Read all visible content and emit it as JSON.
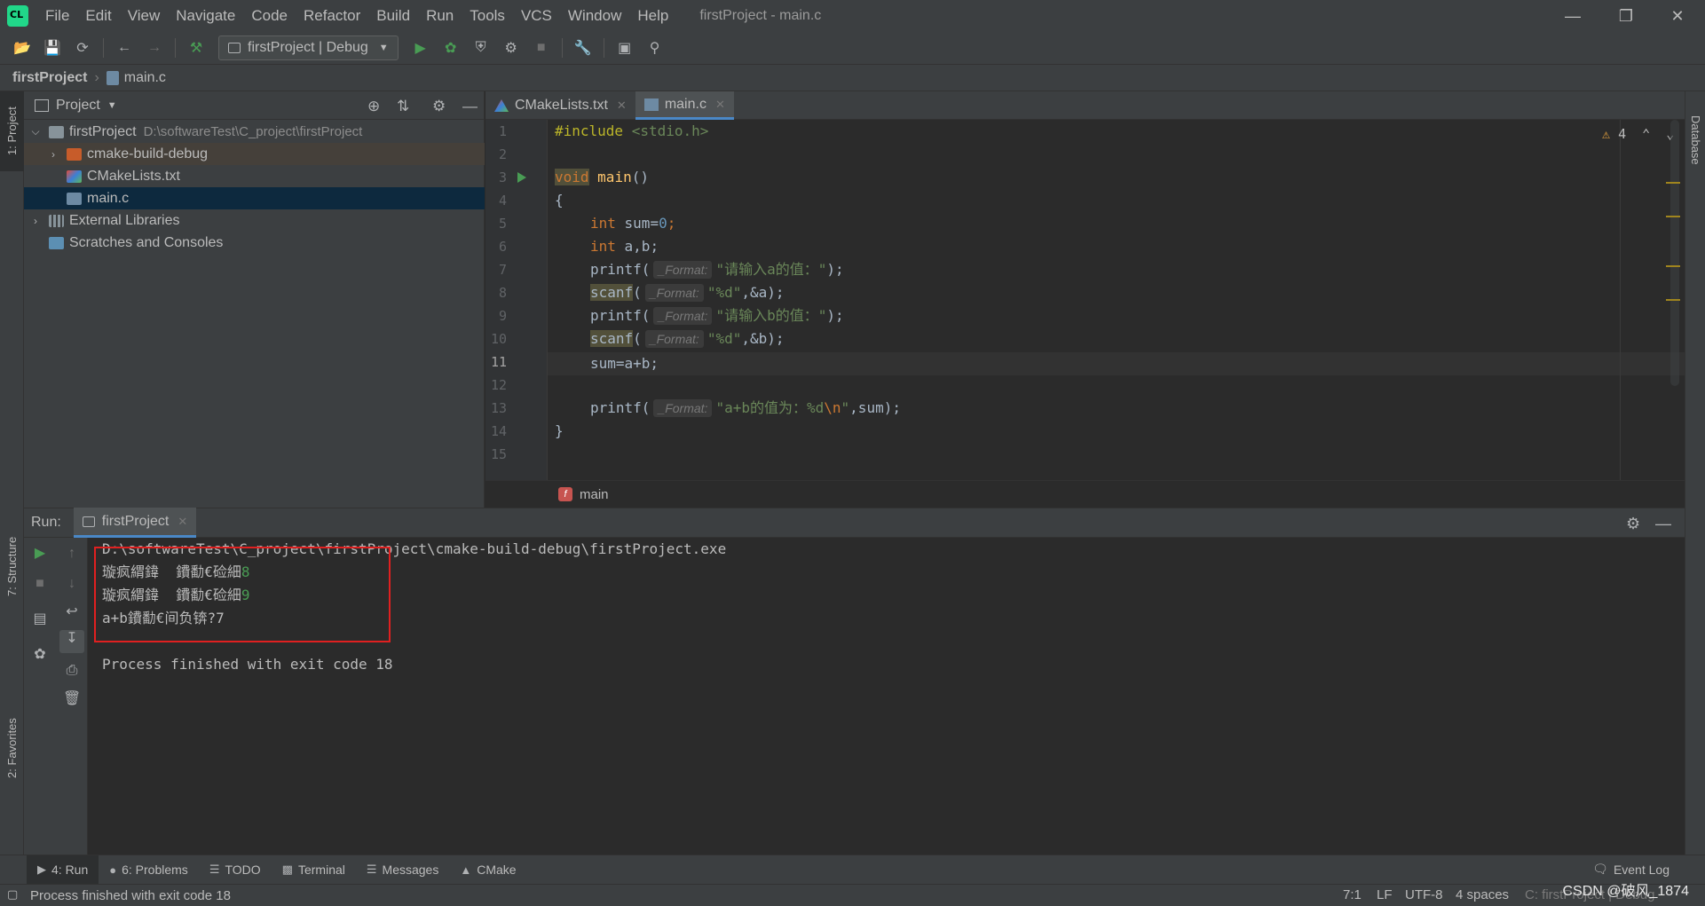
{
  "menu": [
    "File",
    "Edit",
    "View",
    "Navigate",
    "Code",
    "Refactor",
    "Build",
    "Run",
    "Tools",
    "VCS",
    "Window",
    "Help"
  ],
  "window_title": "firstProject - main.c",
  "toolbar": {
    "run_config": "firstProject | Debug"
  },
  "navbar": {
    "project": "firstProject",
    "file": "main.c"
  },
  "left_tabs": {
    "project": "1: Project",
    "structure": "7: Structure",
    "favorites": "2: Favorites"
  },
  "right_tabs": {
    "database": "Database"
  },
  "project_panel": {
    "title": "Project",
    "tree": [
      {
        "label": "firstProject",
        "path": "D:\\softwareTest\\C_project\\firstProject"
      },
      {
        "label": "cmake-build-debug"
      },
      {
        "label": "CMakeLists.txt"
      },
      {
        "label": "main.c"
      },
      {
        "label": "External Libraries"
      },
      {
        "label": "Scratches and Consoles"
      }
    ]
  },
  "editor_tabs": [
    {
      "label": "CMakeLists.txt"
    },
    {
      "label": "main.c"
    }
  ],
  "editor": {
    "line_numbers": [
      "1",
      "2",
      "3",
      "4",
      "5",
      "6",
      "7",
      "8",
      "9",
      "10",
      "11",
      "12",
      "13",
      "14",
      "15"
    ],
    "warning_count": "4",
    "format_hint": "_Format:",
    "breadcrumb_fn": "main",
    "code": {
      "include_kw": "#include",
      "include_hdr": "<stdio.h>",
      "void_kw": "void",
      "main_fn": "main",
      "paren_open_close": "()",
      "brace_open": "{",
      "int_kw": "int",
      "sum_decl": " sum=",
      "zero": "0",
      "semi": ";",
      "ab_decl": " a,b;",
      "printf": "printf",
      "scanf": "scanf",
      "paren_open": "(",
      "str_a": "\"请输入a的值：\"",
      "str_b": "\"请输入b的值：\"",
      "str_d": "\"%d\"",
      "amp_a": ",&a);",
      "amp_b": ",&b);",
      "close_semi": ");",
      "sum_expr": "sum=a+b;",
      "str_sum_pre": "\"a+b的值为：%d",
      "str_sum_esc": "\\n",
      "str_sum_post": "\"",
      "sum_arg": ",sum);",
      "brace_close": "}"
    }
  },
  "run_panel": {
    "label": "Run:",
    "tab": "firstProject",
    "console": {
      "path": "D:\\softwareTest\\C_project\\firstProject\\cmake-build-debug\\firstProject.exe",
      "line1_text": "璇疯緭鍏  鐨勫€硷細",
      "line1_input": "8",
      "line2_text": "璇疯緭鍏  鐨勫€硷細",
      "line2_input": "9",
      "line3_text": "a+b鐨勫€间负锛?7",
      "exit": "Process finished with exit code 18"
    }
  },
  "bottom_tabs": [
    {
      "label": "4: Run"
    },
    {
      "label": "6: Problems"
    },
    {
      "label": "TODO"
    },
    {
      "label": "Terminal"
    },
    {
      "label": "Messages"
    },
    {
      "label": "CMake"
    }
  ],
  "event_log": "Event Log",
  "status": {
    "message": "Process finished with exit code 18",
    "position": "7:1",
    "line_sep": "LF",
    "encoding": "UTF-8",
    "indent": "4 spaces",
    "context": "C: firstProject | Debug"
  },
  "watermark": "CSDN @破风_1874",
  "colors": {
    "keyword": "#cc7832",
    "function": "#ffc66d",
    "string": "#6a8759",
    "number": "#6897bb",
    "accent": "#4a88c7",
    "highlight_box": "#e02020"
  }
}
